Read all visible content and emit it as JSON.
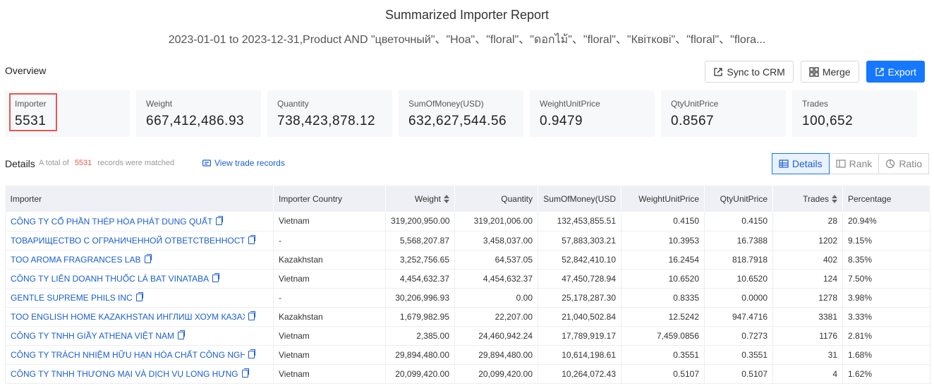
{
  "report": {
    "title": "Summarized Importer Report",
    "subtitle": "2023-01-01 to 2023-12-31,Product AND \"цветочный\"、\"Hoa\"、\"floral\"、\"ดอกไม้\"、\"floral\"、\"Квіткові\"、\"floral\"、\"flora..."
  },
  "overview": {
    "label": "Overview"
  },
  "toolbar": {
    "sync_label": "Sync to CRM",
    "merge_label": "Merge",
    "export_label": "Export"
  },
  "cards": [
    {
      "label": "Importer",
      "value": "5531"
    },
    {
      "label": "Weight",
      "value": "667,412,486.93"
    },
    {
      "label": "Quantity",
      "value": "738,423,878.12"
    },
    {
      "label": "SumOfMoney(USD)",
      "value": "632,627,544.56"
    },
    {
      "label": "WeightUnitPrice",
      "value": "0.9479"
    },
    {
      "label": "QtyUnitPrice",
      "value": "0.8567"
    },
    {
      "label": "Trades",
      "value": "100,652"
    }
  ],
  "details": {
    "title": "Details",
    "meta_prefix": "A total of",
    "count": "5531",
    "meta_suffix": "records were matched",
    "view_link": "View trade records",
    "tabs": [
      "Details",
      "Rank",
      "Ratio"
    ]
  },
  "table": {
    "headers": [
      "Importer",
      "Importer Country",
      "Weight",
      "Quantity",
      "SumOfMoney(USD",
      "WeightUnitPrice",
      "QtyUnitPrice",
      "Trades",
      "Percentage"
    ],
    "rows": [
      [
        "CÔNG TY CỔ PHẦN THÉP HÒA PHÁT DUNG QUẤT",
        "Vietnam",
        "319,200,950.00",
        "319,201,006.00",
        "132,453,855.51",
        "0.4150",
        "0.4150",
        "28",
        "20.94%"
      ],
      [
        "ТОВАРИЩЕСТВО С ОГРАНИЧЕННОЙ ОТВЕТСТВЕННОСТЬЮ IMF",
        "-",
        "5,568,207.87",
        "3,458,037.00",
        "57,883,303.21",
        "10.3953",
        "16.7388",
        "1202",
        "9.15%"
      ],
      [
        "TOO AROMA FRAGRANCES LAB",
        "Kazakhstan",
        "3,252,756.65",
        "64,537.05",
        "52,842,410.10",
        "16.2454",
        "818.7918",
        "402",
        "8.35%"
      ],
      [
        "CÔNG TY LIÊN DOANH THUỐC LÁ BAT VINATABA",
        "Vietnam",
        "4,454,632.37",
        "4,454,632.37",
        "47,450,728.94",
        "10.6520",
        "10.6520",
        "124",
        "7.50%"
      ],
      [
        "GENTLE SUPREME PHILS INC",
        "-",
        "30,206,996.93",
        "0.00",
        "25,178,287.30",
        "0.8335",
        "0.0000",
        "1278",
        "3.98%"
      ],
      [
        "TOO ENGLISH HOME KAZAKHSTAN ИНГЛИШ ХОУМ КАЗАХСТАН",
        "Kazakhstan",
        "1,679,982.95",
        "22,207.00",
        "21,040,502.84",
        "12.5242",
        "947.4716",
        "3381",
        "3.33%"
      ],
      [
        "CÔNG TY TNHH GIẦY ATHENA VIỆT NAM",
        "Vietnam",
        "2,385.00",
        "24,460,942.24",
        "17,789,919.17",
        "7,459.0856",
        "0.7273",
        "1176",
        "2.81%"
      ],
      [
        "CÔNG TY TRÁCH NHIỆM HỮU HẠN HÓA CHẤT CÔNG NGHỆ SAMS",
        "Vietnam",
        "29,894,480.00",
        "29,894,480.00",
        "10,614,198.61",
        "0.3551",
        "0.3551",
        "31",
        "1.68%"
      ],
      [
        "CÔNG TY TNHH THƯƠNG MẠI VÀ DỊCH VỤ LONG HƯNG",
        "Vietnam",
        "20,099,420.00",
        "20,099,420.00",
        "10,264,072.43",
        "0.5107",
        "0.5107",
        "4",
        "1.62%"
      ]
    ]
  }
}
